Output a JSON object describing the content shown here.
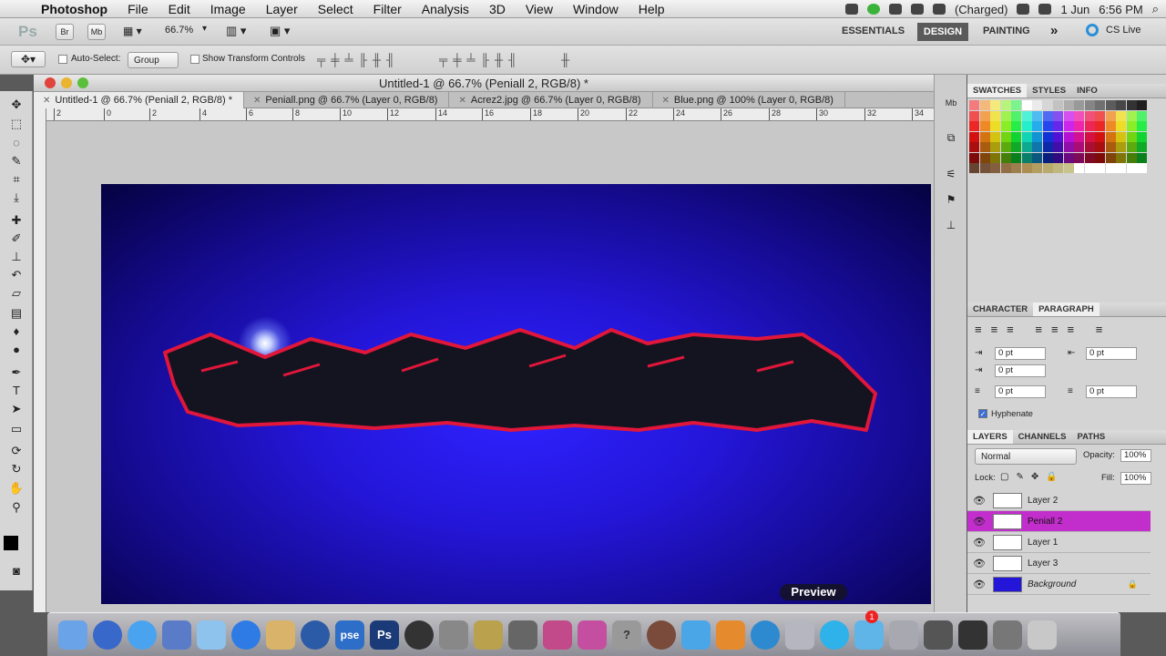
{
  "menubar": {
    "apple_icon": "apple-logo",
    "app": "Photoshop",
    "items": [
      "File",
      "Edit",
      "Image",
      "Layer",
      "Select",
      "Filter",
      "Analysis",
      "3D",
      "View",
      "Window",
      "Help"
    ],
    "battery": "(Charged)",
    "date": "1 Jun",
    "time": "6:56 PM"
  },
  "appbar": {
    "ps": "Ps",
    "br": "Br",
    "mb": "Mb",
    "zoom": "66.7%",
    "workspaces": [
      "ESSENTIALS",
      "DESIGN",
      "PAINTING"
    ],
    "more": "»",
    "cslive": "CS Live"
  },
  "options": {
    "autoselect": "Auto-Select:",
    "group": "Group",
    "transform": "Show Transform Controls"
  },
  "doc": {
    "title": "Untitled-1 @ 66.7% (Peniall 2, RGB/8) *",
    "tabs": [
      "Untitled-1 @ 66.7% (Peniall 2, RGB/8) *",
      "Peniall.png @ 66.7% (Layer 0, RGB/8)",
      "Acrez2.jpg @ 66.7% (Layer 0, RGB/8)",
      "Blue.png @ 100% (Layer 0, RGB/8)"
    ],
    "ruler": [
      "2",
      "0",
      "2",
      "4",
      "6",
      "8",
      "10",
      "12",
      "14",
      "16",
      "18",
      "20",
      "22",
      "24",
      "26",
      "28",
      "30",
      "32",
      "34"
    ]
  },
  "panels": {
    "swatches_tabs": [
      "SWATCHES",
      "STYLES",
      "INFO"
    ],
    "char_tabs": [
      "CHARACTER",
      "PARAGRAPH"
    ],
    "para_fields": [
      "0 pt",
      "0 pt",
      "0 pt",
      "0 pt",
      "0 pt"
    ],
    "hyphenate": "Hyphenate",
    "layer_tabs": [
      "LAYERS",
      "CHANNELS",
      "PATHS"
    ],
    "blend": "Normal",
    "opacity_label": "Opacity:",
    "opacity": "100%",
    "lock": "Lock:",
    "fill_label": "Fill:",
    "fill": "100%",
    "layers": [
      "Layer 2",
      "Peniall 2",
      "Layer 1",
      "Layer 3",
      "Background"
    ]
  },
  "dock_tooltip": "Preview",
  "dock_badge": "1",
  "dock_items": [
    "pse",
    "Ps"
  ],
  "colors": {
    "selected_layer": "#c22ecc",
    "canvas": "#2416d8",
    "accent": "#3a6fd8"
  }
}
